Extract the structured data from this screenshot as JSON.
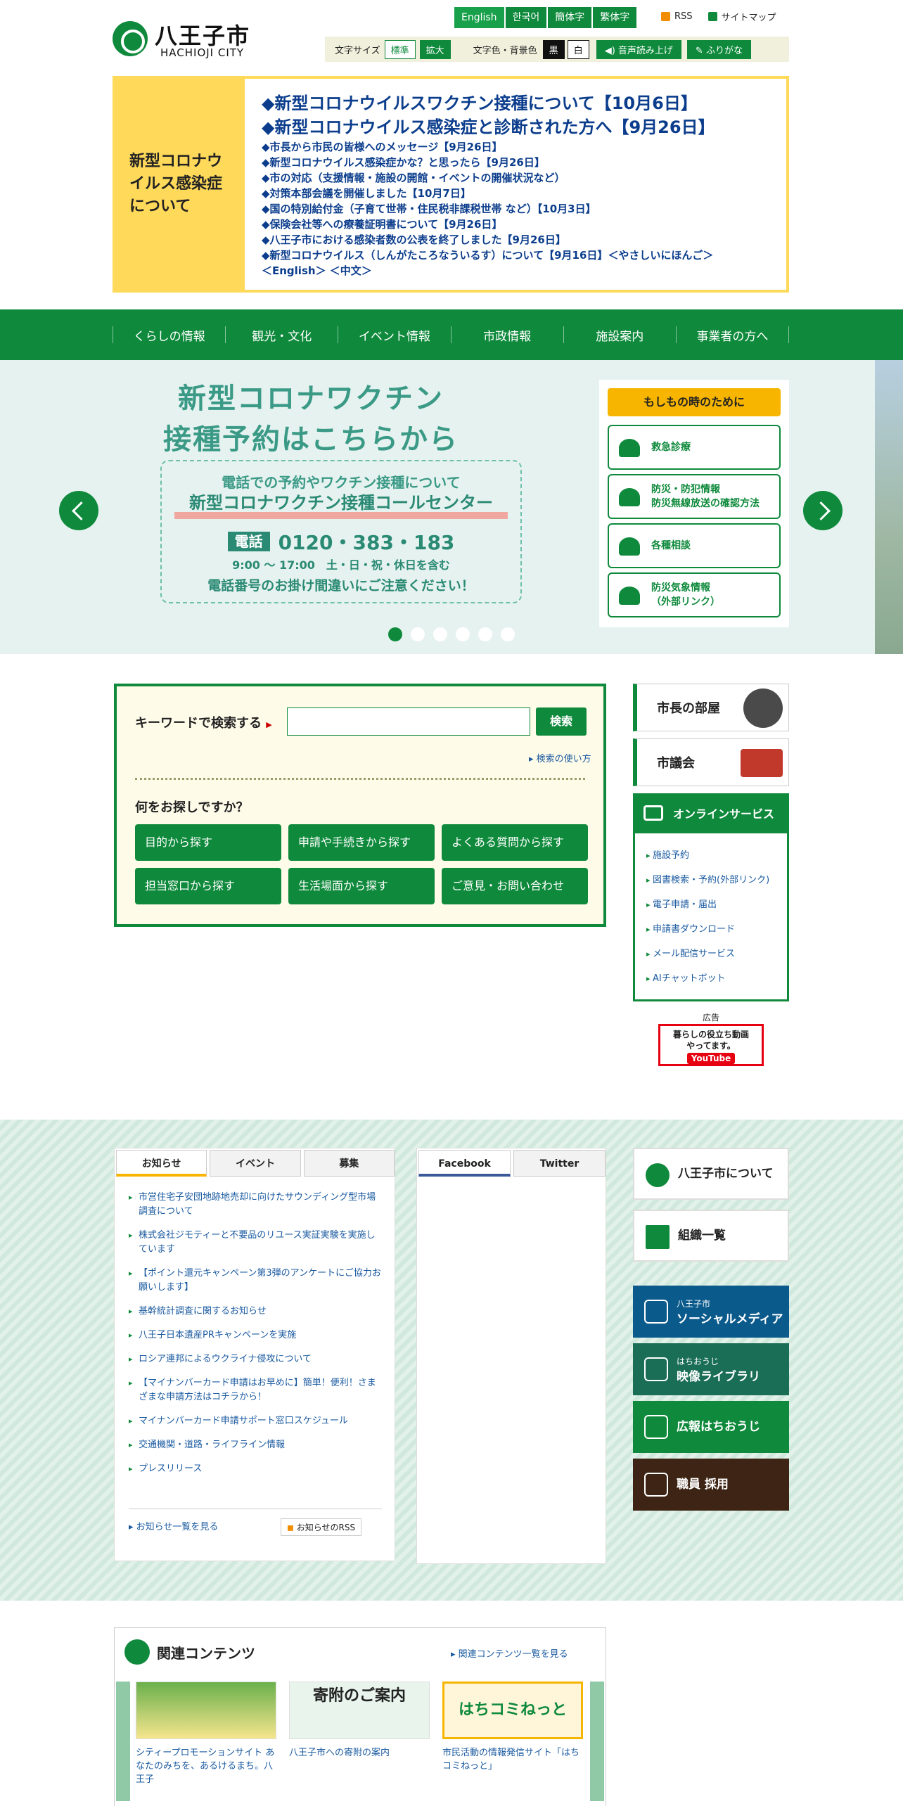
{
  "header": {
    "logo_jp": "八王子市",
    "logo_en": "HACHIOJI CITY",
    "languages": [
      "English",
      "한국어",
      "簡体字",
      "繁体字"
    ],
    "rss": "RSS",
    "sitemap": "サイトマップ",
    "font_size_label": "文字サイズ",
    "font_standard": "標準",
    "font_large": "拡大",
    "color_label": "文字色・背景色",
    "color_black": "黒",
    "color_white": "白",
    "read_aloud": "音声読み上げ",
    "furigana": "ふりがな"
  },
  "covid": {
    "title": "新型コロナウイルス感染症について",
    "links": [
      "◆新型コロナウイルスワクチン接種について【10月6日】",
      "◆新型コロナウイルス感染症と診断された方へ【9月26日】",
      "◆市長から市民の皆様へのメッセージ【9月26日】",
      "◆新型コロナウイルス感染症かな？と思ったら【9月26日】",
      "◆市の対応（支援情報・施設の開館・イベントの開催状況など）",
      "◆対策本部会議を開催しました【10月7日】",
      "◆国の特別給付金（子育て世帯・住民税非課税世帯 など）【10月3日】",
      "◆保険会社等への療養証明書について【9月26日】",
      "◆八王子市における感染者数の公表を終了しました【9月26日】",
      "◆新型コロナウイルス（しんがたころなういるす）について【9月16日】＜やさしいにほんご＞",
      "＜English＞ ＜中文＞"
    ]
  },
  "nav": [
    "くらしの情報",
    "観光・文化",
    "イベント情報",
    "市政情報",
    "施設案内",
    "事業者の方へ"
  ],
  "hero": {
    "title1": "新型コロナワクチン",
    "title2": "接種予約はこちらから",
    "box_line1": "電話での予約やワクチン接種について",
    "box_line2": "新型コロナワクチン接種コールセンター",
    "tel_label": "電話",
    "tel": "0120・383・183",
    "hours": "9:00 ～ 17:00　土・日・祝・休日を含む",
    "note": "電話番号のお掛け間違いにご注意ください！",
    "slide_count": 6,
    "active_slide": 1
  },
  "emergency": {
    "title": "もしもの時のために",
    "items": [
      "救急診療",
      "防災・防犯情報\n防災無線放送の確認方法",
      "各種相談",
      "防災気象情報\n（外部リンク）"
    ]
  },
  "search": {
    "keyword_label": "キーワードで検索する",
    "input_value": "",
    "button": "検索",
    "how_to": "検索の使い方",
    "question": "何をお探しですか？",
    "buttons": [
      "目的から探す",
      "申請や手続きから探す",
      "よくある質問から探す",
      "担当窓口から探す",
      "生活場面から探す",
      "ご意見・お問い合わせ"
    ]
  },
  "side": {
    "mayor": "市長の部屋",
    "council": "市議会",
    "online_title": "オンラインサービス",
    "online_items": [
      "施設予約",
      "図書検索・予約(外部リンク)",
      "電子申請・届出",
      "申請書ダウンロード",
      "メール配信サービス",
      "AIチャットボット"
    ],
    "ad_label": "広告",
    "ad_text1": "暮らしの役立ち動画",
    "ad_text2": "やってます。",
    "ad_brand": "YouTube"
  },
  "news": {
    "tabs": [
      "お知らせ",
      "イベント",
      "募集"
    ],
    "items": [
      "市営住宅子安団地跡地売却に向けたサウンディング型市場調査について",
      "株式会社ジモティーと不要品のリユース実証実験を実施しています",
      "【ポイント還元キャンペーン第3弾のアンケートにご協力お願いします】",
      "基幹統計調査に関するお知らせ",
      "八王子日本遺産PRキャンペーンを実施",
      "ロシア連邦によるウクライナ侵攻について",
      "【マイナンバーカード申請はお早めに】簡単！便利！さまざまな申請方法はコチラから！",
      "マイナンバーカード申請サポート窓口スケジュール",
      "交通機関・道路・ライフライン情報",
      "プレスリリース"
    ],
    "list_link": "お知らせ一覧を見る",
    "rss_link": "お知らせのRSS"
  },
  "sns": {
    "tabs": [
      "Facebook",
      "Twitter"
    ]
  },
  "right_links": {
    "about": "八王子市について",
    "org": "組織一覧",
    "social_small": "八王子市",
    "social": "ソーシャルメディア",
    "video_small": "はちおうじ",
    "video": "映像ライブラリ",
    "koho": "広報はちおうじ",
    "recruit": "職員 採用"
  },
  "related": {
    "title": "関連コンテンツ",
    "more": "関連コンテンツ一覧を見る",
    "cards": [
      {
        "img": "シティプロモーションサイト",
        "caption": "シティープロモーションサイト あなたのみちを、あるけるまち。八王子"
      },
      {
        "img": "寄附のご案内",
        "caption": "八王子市への寄附の案内"
      },
      {
        "img": "はちコミねっと",
        "caption": "市民活動の情報発信サイト「はちコミねっと」"
      }
    ]
  },
  "colors": {
    "primary": "#0f8a3c",
    "accent": "#f7b500",
    "covid_bg": "#ffd95a",
    "social": "#0b5a8c",
    "video": "#1a6e56",
    "recruit": "#3d2414"
  }
}
